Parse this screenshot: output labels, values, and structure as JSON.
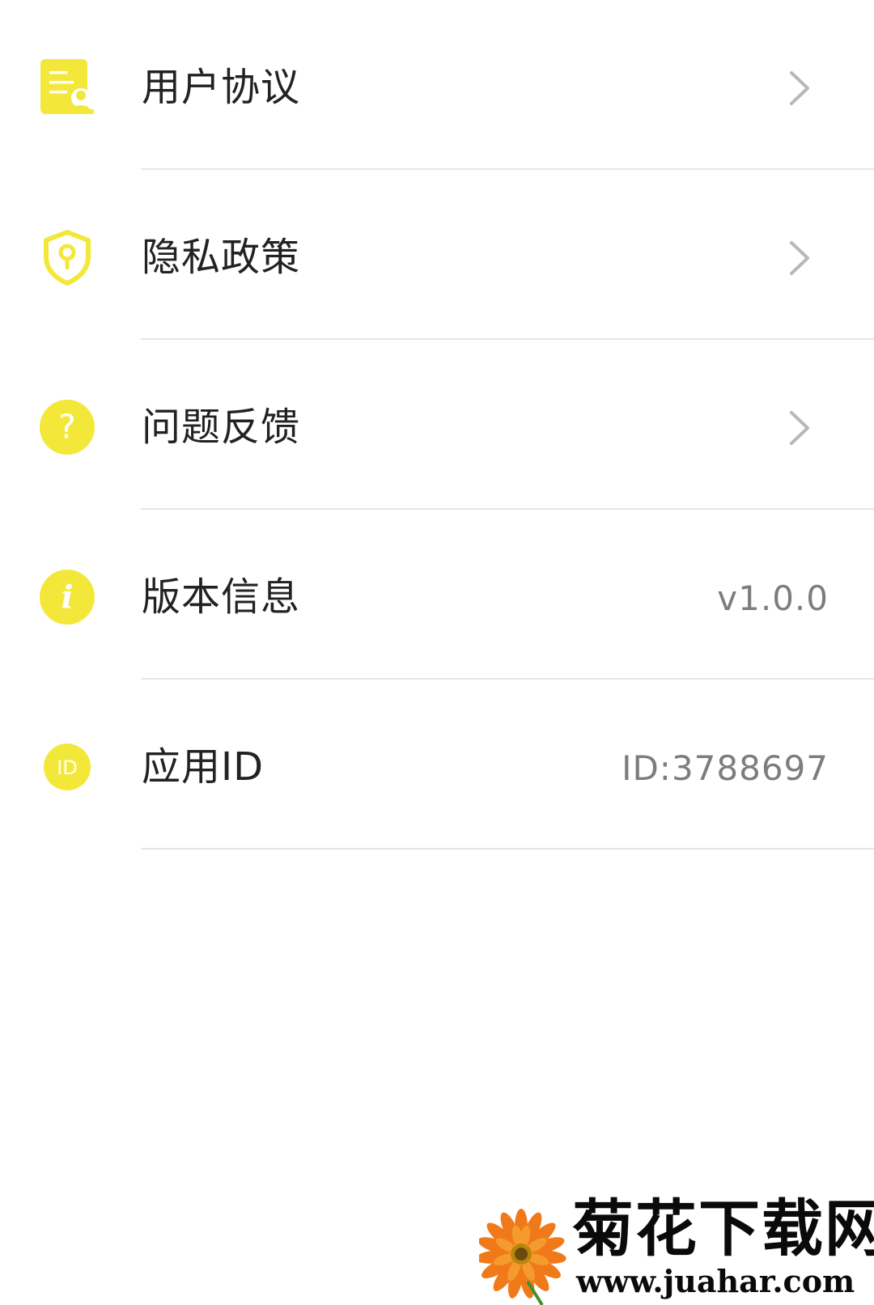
{
  "menu": {
    "items": [
      {
        "icon": "user-agreement-icon",
        "label": "用户协议",
        "trailing": "chevron"
      },
      {
        "icon": "privacy-shield-icon",
        "label": "隐私政策",
        "trailing": "chevron"
      },
      {
        "icon": "question-icon",
        "label": "问题反馈",
        "trailing": "chevron",
        "icon_glyph": "?"
      },
      {
        "icon": "info-icon",
        "label": "版本信息",
        "trailing": "value",
        "value": "v1.0.0",
        "icon_glyph": "i"
      },
      {
        "icon": "app-id-icon",
        "label": "应用ID",
        "trailing": "value",
        "value": "ID:3788697",
        "icon_glyph": "ID"
      }
    ]
  },
  "watermark": {
    "title": "菊花下载网",
    "url": "www.juahar.com"
  },
  "colors": {
    "accent_yellow": "#F3E83A",
    "label_text": "#222222",
    "value_text": "#7D7D7D",
    "chevron": "#B5B9BE",
    "divider": "#E6E6E6"
  }
}
